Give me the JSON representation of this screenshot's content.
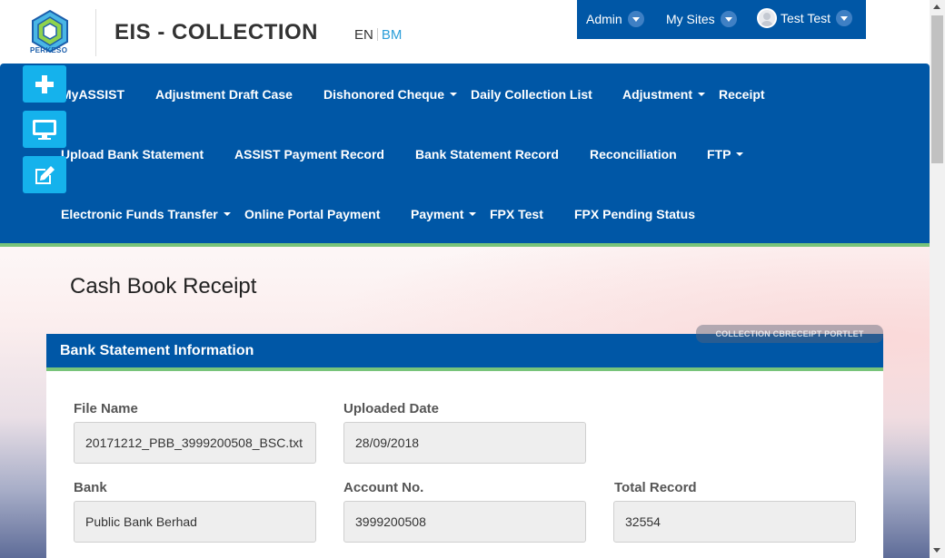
{
  "header": {
    "logo_text": "PERKESO",
    "app_title": "EIS - COLLECTION",
    "lang_en": "EN",
    "lang_bm": "BM"
  },
  "userbar": {
    "admin": "Admin",
    "my_sites": "My Sites",
    "user_name": "Test Test"
  },
  "nav": {
    "row1": [
      {
        "label": "MyASSIST",
        "dropdown": false
      },
      {
        "label": "Adjustment Draft Case",
        "dropdown": false
      },
      {
        "label": "Dishonored Cheque",
        "dropdown": true
      },
      {
        "label": "Daily Collection List",
        "dropdown": false
      },
      {
        "label": "Adjustment",
        "dropdown": true
      },
      {
        "label": "Receipt",
        "dropdown": false
      }
    ],
    "row2": [
      {
        "label": "Upload Bank Statement",
        "dropdown": false
      },
      {
        "label": "ASSIST Payment Record",
        "dropdown": false
      },
      {
        "label": "Bank Statement Record",
        "dropdown": false
      },
      {
        "label": "Reconciliation",
        "dropdown": false
      },
      {
        "label": "FTP",
        "dropdown": true
      }
    ],
    "row3": [
      {
        "label": "Electronic Funds Transfer",
        "dropdown": true
      },
      {
        "label": "Online Portal Payment",
        "dropdown": false
      },
      {
        "label": "Payment",
        "dropdown": true
      },
      {
        "label": "FPX Test",
        "dropdown": false
      },
      {
        "label": "FPX Pending Status",
        "dropdown": false
      }
    ]
  },
  "quick_buttons": [
    "add-icon",
    "monitor-icon",
    "edit-icon"
  ],
  "page_title": "Cash Book Receipt",
  "portlet": {
    "tag": "COLLECTION CBRECEIPT PORTLET",
    "title": "Bank Statement Information",
    "fields": {
      "file_name": {
        "label": "File Name",
        "value": "20171212_PBB_3999200508_BSC.txt"
      },
      "uploaded_date": {
        "label": "Uploaded Date",
        "value": "28/09/2018"
      },
      "bank": {
        "label": "Bank",
        "value": "Public Bank Berhad"
      },
      "account_no": {
        "label": "Account No.",
        "value": "3999200508"
      },
      "total_record": {
        "label": "Total Record",
        "value": "32554"
      }
    }
  },
  "colors": {
    "primary": "#0057a6",
    "accent_green": "#78c47a",
    "quick_button": "#15b2ec",
    "lang_link": "#2d9fd9"
  }
}
